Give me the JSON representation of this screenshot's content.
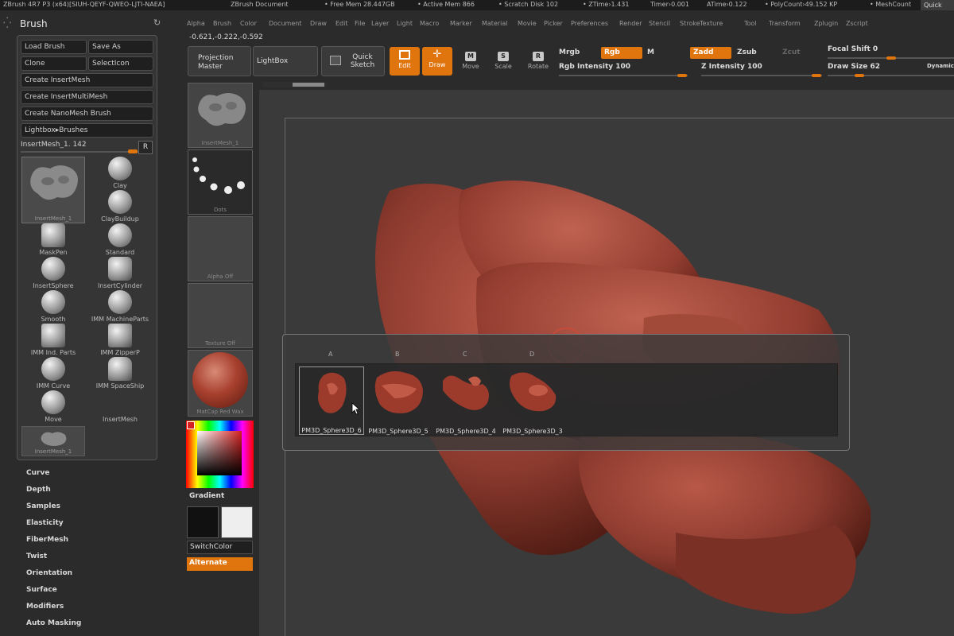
{
  "titlebar": {
    "app": "ZBrush 4R7 P3 (x64)[SIUH-QEYF-QWEO-LJTI-NAEA]",
    "document": "ZBrush Document",
    "free_mem": "• Free Mem 28.447GB",
    "active_mem": "• Active Mem 866",
    "scratch": "• Scratch Disk 102",
    "ztime": "• ZTime›1.431",
    "timer": "Timer›0.001",
    "atime": "ATime›0.122",
    "polycount": "• PolyCount›49.152 KP",
    "meshcount": "• MeshCount",
    "quick": "Quick"
  },
  "menu": [
    "Alpha",
    "Brush",
    "Color",
    "Document",
    "Draw",
    "Edit",
    "File",
    "Layer",
    "Light",
    "Macro",
    "Marker",
    "Material",
    "Movie",
    "Picker",
    "Preferences",
    "Render",
    "Stencil",
    "Stroke",
    "Texture",
    "Tool",
    "Transform",
    "Zplugin",
    "Zscript"
  ],
  "coords": "-0.621,-0.222,-0.592",
  "brush_palette": {
    "title": "Brush",
    "buttons": {
      "load_brush": "Load Brush",
      "save_as": "Save As",
      "clone": "Clone",
      "select_icon": "SelectIcon",
      "create_insertmesh": "Create InsertMesh",
      "create_insertmultimesh": "Create InsertMultiMesh",
      "create_nanomesh": "Create NanoMesh Brush",
      "lightbox_brushes": "Lightbox▸Brushes"
    },
    "slider_label": "InsertMesh_1. 142",
    "r_button": "R",
    "brushes": [
      {
        "name": "InsertMesh_1"
      },
      {
        "name": "Clay"
      },
      {
        "name": "ClayBuildup"
      },
      {
        "name": "MaskPen"
      },
      {
        "name": "Standard"
      },
      {
        "name": "InsertSphere"
      },
      {
        "name": "InsertCylinder"
      },
      {
        "name": "Smooth"
      },
      {
        "name": "IMM MachineParts"
      },
      {
        "name": "IMM Ind. Parts"
      },
      {
        "name": "IMM ZipperP"
      },
      {
        "name": "IMM Curve"
      },
      {
        "name": "IMM SpaceShip"
      },
      {
        "name": "Move"
      },
      {
        "name": "InsertMesh"
      },
      {
        "name": "InsertMesh_1"
      }
    ]
  },
  "sections": [
    "Curve",
    "Depth",
    "Samples",
    "Elasticity",
    "FiberMesh",
    "Twist",
    "Orientation",
    "Surface",
    "Modifiers",
    "Auto Masking"
  ],
  "thumbs": {
    "insertmesh": "InsertMesh_1",
    "dots": "Dots",
    "alpha": "Alpha Off",
    "texture": "Texture Off",
    "matcap": "MatCap Red Wax"
  },
  "color": {
    "gradient_label": "Gradient",
    "switchcolor": "SwitchColor",
    "alternate": "Alternate"
  },
  "toolbar": {
    "projection_master": "Projection Master",
    "lightbox": "LightBox",
    "quick_sketch": "Quick Sketch",
    "edit": "Edit",
    "draw": "Draw",
    "move": "Move",
    "scale": "Scale",
    "rotate": "Rotate",
    "mrgb": "Mrgb",
    "rgb": "Rgb",
    "m": "M",
    "zadd": "Zadd",
    "zsub": "Zsub",
    "zcut": "Zcut",
    "rgb_intensity": "Rgb Intensity 100",
    "z_intensity": "Z Intensity 100",
    "focal_shift": "Focal Shift 0",
    "draw_size": "Draw Size 62",
    "dynamic": "Dynamic"
  },
  "popup": {
    "columns": [
      "A",
      "B",
      "C",
      "D"
    ],
    "items": [
      {
        "label": "PM3D_Sphere3D_6"
      },
      {
        "label": "PM3D_Sphere3D_5"
      },
      {
        "label": "PM3D_Sphere3D_4"
      },
      {
        "label": "PM3D_Sphere3D_3"
      }
    ]
  },
  "colors": {
    "accent": "#e0740d",
    "model": "#8c3a2e"
  }
}
